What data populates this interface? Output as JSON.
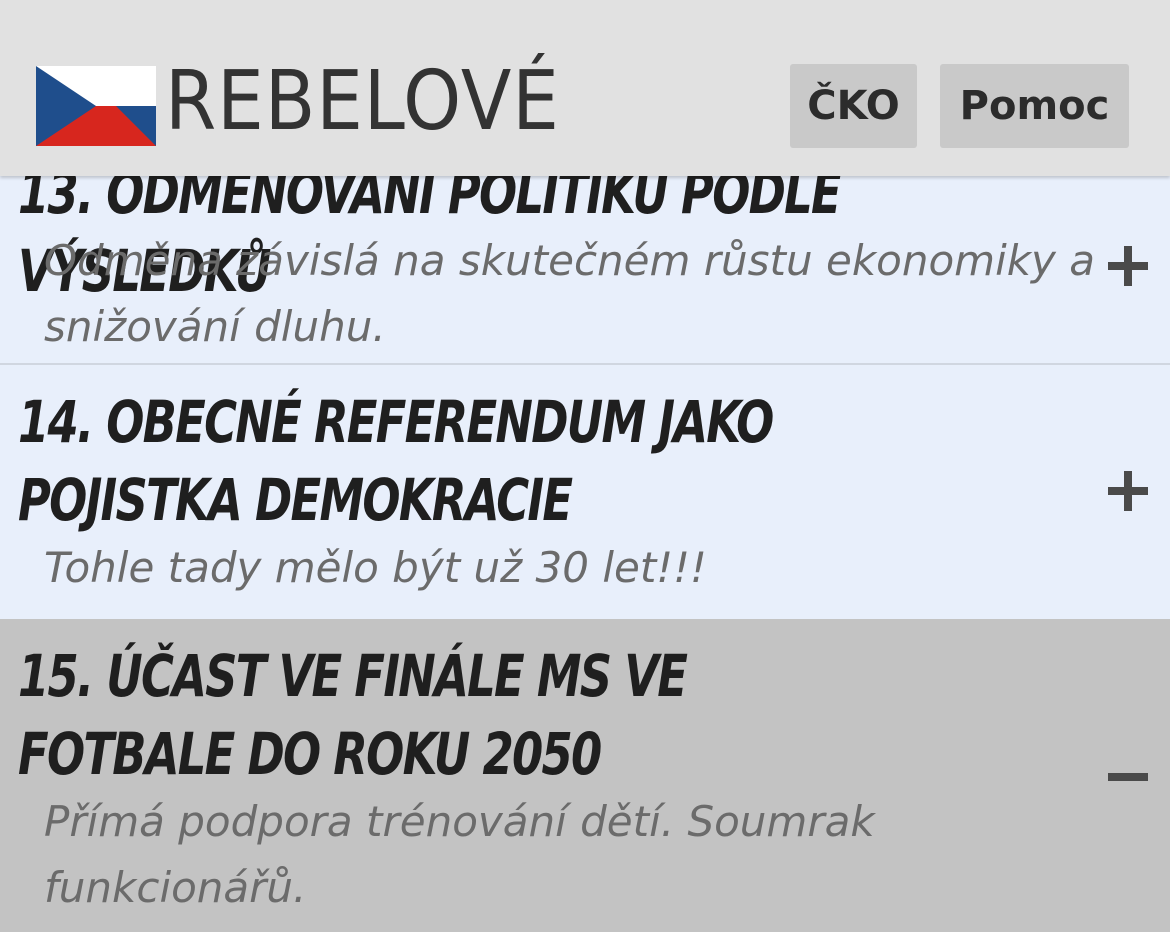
{
  "header": {
    "logo_text": "REBELOVÉ",
    "buttons": [
      {
        "label": "ČKO"
      },
      {
        "label": "Pomoc"
      }
    ],
    "flag_icon": "czech-flag",
    "colors": {
      "flag_blue": "#1f4e8c",
      "flag_red": "#d7261e",
      "flag_white": "#ffffff",
      "header_bg": "#e1e1e1"
    }
  },
  "items": [
    {
      "title": "13. Odměňování politiků podle výsledků",
      "description": "Odměna závislá na skutečném růstu ekonomiky a snižování dluhu.",
      "state": "collapsed",
      "toggle_icon": "plus-icon"
    },
    {
      "title": "14. Obecné referendum jako pojistka demokracie",
      "description": "Tohle tady mělo být už 30 let!!!",
      "state": "collapsed",
      "toggle_icon": "plus-icon"
    },
    {
      "title": "15. Účast ve finále MS ve fotbale do roku 2050",
      "description": "Přímá podpora trénování dětí. Soumrak funkcionářů.",
      "state": "expanded",
      "toggle_icon": "minus-icon"
    }
  ],
  "colors": {
    "collapsed_bg": "#e8effb",
    "expanded_bg": "#c3c3c3",
    "title_color": "#1f1f1f",
    "description_color": "#6b6b6b"
  }
}
